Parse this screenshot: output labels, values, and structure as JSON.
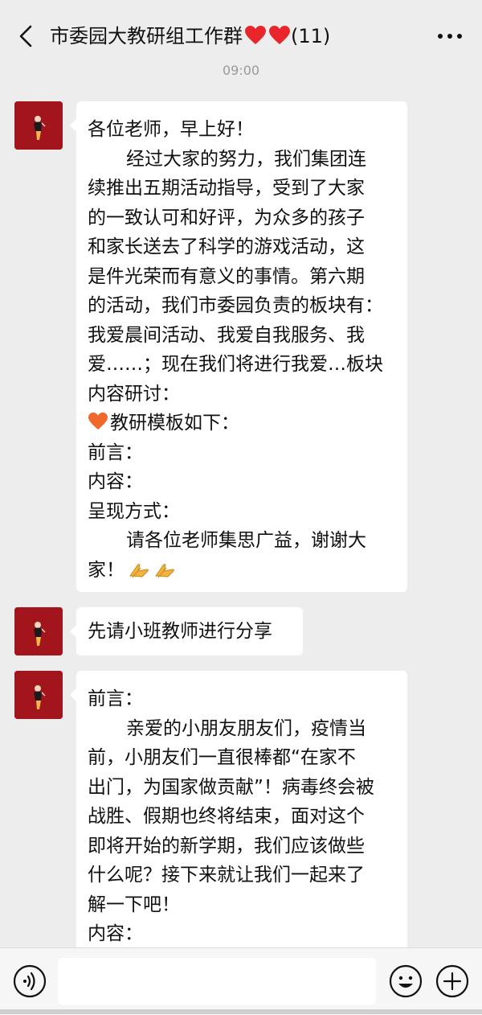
{
  "header": {
    "title": "市委园大教研组工作群",
    "member_count": "(11)"
  },
  "timestamp": "09:00",
  "messages": [
    {
      "lines": [
        "各位老师，早上好！",
        "经过大家的努力，我们集团连",
        "续推出五期活动指导，受到了大家",
        "的一致认可和好评，为众多的孩子",
        "和家长送去了科学的游戏活动，这",
        "是件光荣而有意义的事情。第六期",
        "的活动，我们市委园负责的板块有：",
        "我爱晨间活动、我爱自我服务、我",
        "爱……；现在我们将进行我爱…板块",
        "内容研讨：",
        "教研模板如下：",
        "前言：",
        "内容：",
        "呈现方式：",
        "请各位老师集思广益，谢谢大",
        "家！"
      ]
    },
    {
      "lines": [
        "先请小班教师进行分享"
      ]
    },
    {
      "lines": [
        "前言：",
        "亲爱的小朋友朋友们，疫情当",
        "前，小朋友们一直很棒都“在家不",
        "出门，为国家做贡献”！病毒终会被",
        "战胜、假期也终将结束，面对这个",
        "即将开始的新学期，我们应该做些",
        "什么呢？接下来就让我们一起来了",
        "解一下吧！",
        "内容："
      ]
    }
  ],
  "input": {
    "placeholder": ""
  },
  "colors": {
    "background": "#ededed",
    "bubble": "#ffffff",
    "avatar": "#a3151c",
    "heart": "#e8262b"
  }
}
